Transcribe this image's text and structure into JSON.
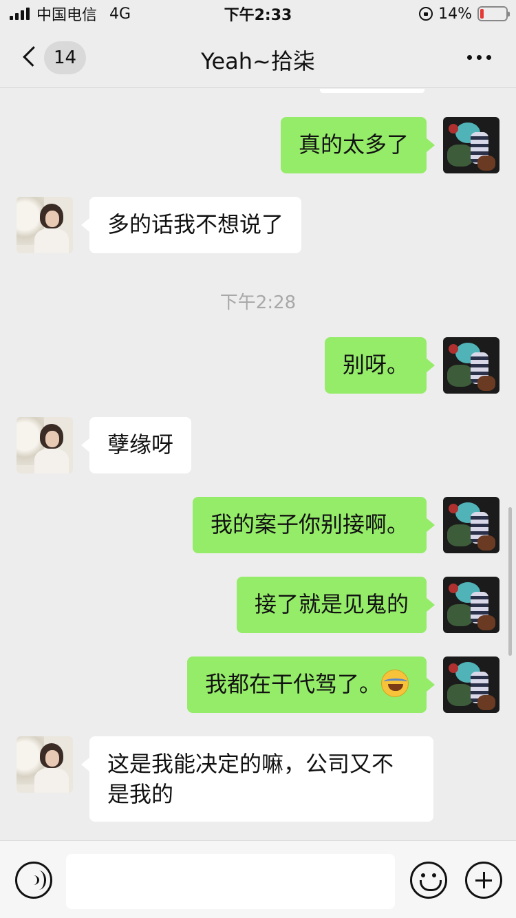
{
  "status_bar": {
    "carrier": "中国电信",
    "network": "4G",
    "time": "下午2:33",
    "battery_percent": "14%",
    "battery_level": 0.14
  },
  "nav": {
    "unread_count": "14",
    "title": "Yeah~拾柒"
  },
  "chat": {
    "messages": [
      {
        "side": "self",
        "text": "真的太多了"
      },
      {
        "side": "other",
        "text": "多的话我不想说了"
      },
      {
        "timestamp": "下午2:28"
      },
      {
        "side": "self",
        "text": "别呀。"
      },
      {
        "side": "other",
        "text": "孽缘呀"
      },
      {
        "side": "self",
        "text": "我的案子你别接啊。"
      },
      {
        "side": "self",
        "text": "接了就是见鬼的"
      },
      {
        "side": "self",
        "text": "我都在干代驾了。",
        "emoji": "loudly-crying-face-icon"
      },
      {
        "side": "other",
        "text": "这是我能决定的嘛，公司又不\n是我的"
      }
    ]
  },
  "input": {
    "value": ""
  },
  "colors": {
    "self_bubble": "#95ec69",
    "other_bubble": "#ffffff",
    "background": "#ededed"
  }
}
